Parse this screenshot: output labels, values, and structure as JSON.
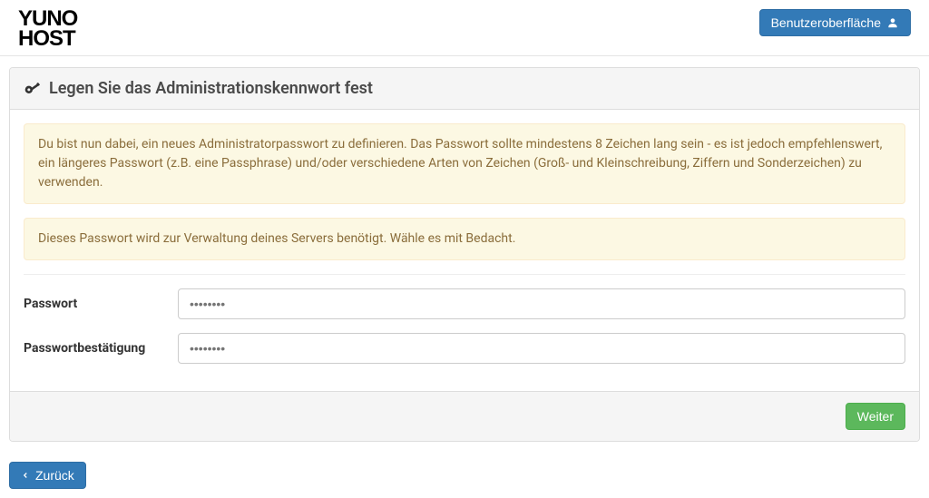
{
  "header": {
    "logo_line1": "Yuno",
    "logo_line2": "Host",
    "user_interface_btn": "Benutzeroberfläche"
  },
  "panel": {
    "title": "Legen Sie das Administrationskennwort fest",
    "alert1": "Du bist nun dabei, ein neues Administratorpasswort zu definieren. Das Passwort sollte mindestens 8 Zeichen lang sein - es ist jedoch empfehlenswert, ein längeres Passwort (z.B. eine Passphrase) und/oder verschiedene Arten von Zeichen (Groß- und Kleinschreibung, Ziffern und Sonderzeichen) zu verwenden.",
    "alert2": "Dieses Passwort wird zur Verwaltung deines Servers benötigt. Wähle es mit Bedacht.",
    "password_label": "Passwort",
    "password_placeholder": "••••••••",
    "confirm_label": "Passwortbestätigung",
    "confirm_placeholder": "••••••••",
    "next_btn": "Weiter"
  },
  "nav": {
    "back_btn": "Zurück"
  }
}
